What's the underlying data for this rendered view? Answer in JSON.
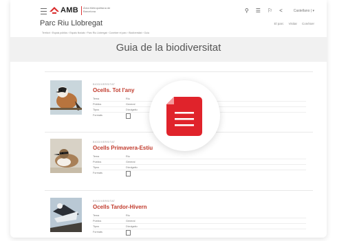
{
  "header": {
    "logo_text": "AMB",
    "logo_sub": "Àrea Metropolitana de Barcelona",
    "lang": "Castellano | ▾"
  },
  "subheader": {
    "park": "Parc Riu Llobregat",
    "links": [
      "El parc",
      "Visitar",
      "Conèixer"
    ]
  },
  "breadcrumb": "Territori › Espais públics › Espais fluvials › Parc Riu Llobregat › Conèixer el parc › Biodiversitat › Guia",
  "page_title": "Guia de la biodiversitat",
  "entries": [
    {
      "tag": "BIODIVERSITAT",
      "title": "Ocells. Tot l'any",
      "rows": [
        {
          "k": "Tema",
          "v": "Riu"
        },
        {
          "k": "Públics",
          "v": "General"
        },
        {
          "k": "Tipus",
          "v": "Divulgatiu"
        },
        {
          "k": "Formats",
          "v": ""
        }
      ]
    },
    {
      "tag": "BIODIVERSITAT",
      "title": "Ocells Primavera-Estiu",
      "rows": [
        {
          "k": "Tema",
          "v": "Riu"
        },
        {
          "k": "Públics",
          "v": "General"
        },
        {
          "k": "Tipus",
          "v": "Divulgatiu"
        },
        {
          "k": "Formats",
          "v": ""
        }
      ]
    },
    {
      "tag": "BIODIVERSITAT",
      "title": "Ocells Tardor-Hivern",
      "rows": [
        {
          "k": "Tema",
          "v": "Riu"
        },
        {
          "k": "Públics",
          "v": "General"
        },
        {
          "k": "Tipus",
          "v": "Divulgatiu"
        },
        {
          "k": "Formats",
          "v": ""
        }
      ]
    }
  ],
  "colors": {
    "accent": "#d92a2a",
    "title_red": "#c0392b",
    "band": "#f1f1f1"
  },
  "icons": [
    "menu-icon",
    "search-icon",
    "grid-icon",
    "pin-icon",
    "share-icon",
    "document-icon"
  ]
}
